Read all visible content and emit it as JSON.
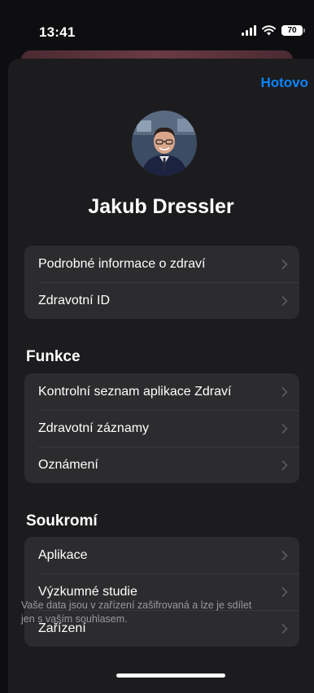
{
  "status_bar": {
    "time": "13:41",
    "battery": "70"
  },
  "sheet": {
    "done_label": "Hotovo",
    "profile_name": "Jakub Dressler",
    "profile_group": [
      {
        "label": "Podrobné informace o zdraví"
      },
      {
        "label": "Zdravotní ID"
      }
    ],
    "features": {
      "title": "Funkce",
      "items": [
        {
          "label": "Kontrolní seznam aplikace Zdraví"
        },
        {
          "label": "Zdravotní záznamy"
        },
        {
          "label": "Oznámení"
        }
      ]
    },
    "privacy": {
      "title": "Soukromí",
      "items": [
        {
          "label": "Aplikace"
        },
        {
          "label": "Výzkumné studie"
        },
        {
          "label": "Zařízení"
        }
      ]
    },
    "footer_note": "Vaše data jsou v zařízení zašifrovaná a lze je sdílet jen s vaším souhlasem."
  },
  "colors": {
    "accent": "#0a84ff",
    "background": "#0e0e10",
    "sheet": "#1c1c1e",
    "group": "#2c2c2e"
  },
  "icons": [
    "signal-icon",
    "wifi-icon",
    "battery-icon",
    "chevron-right-icon"
  ]
}
